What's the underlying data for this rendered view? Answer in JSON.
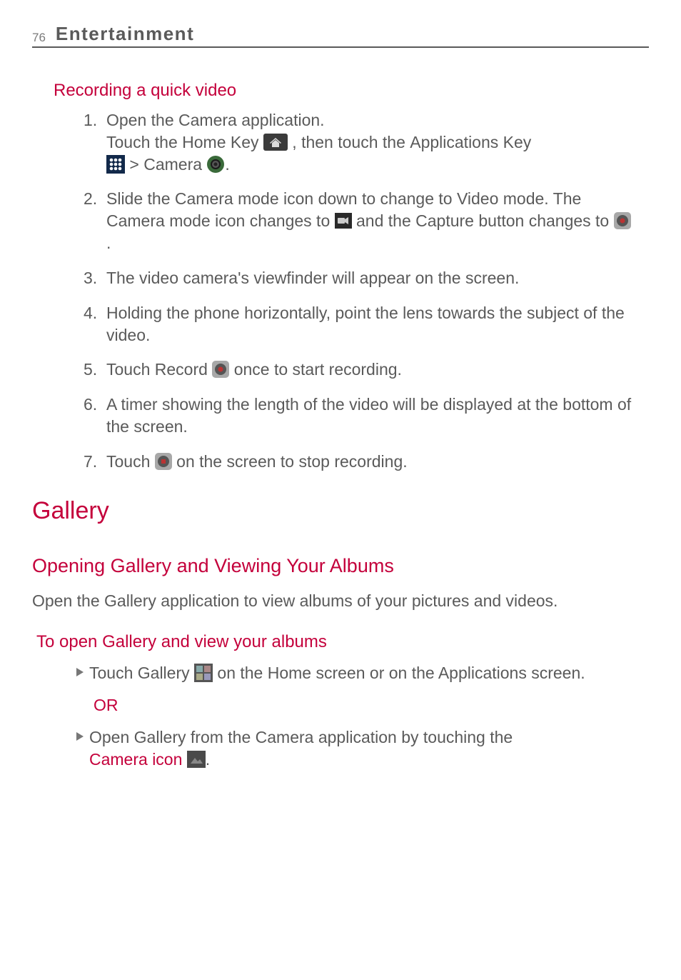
{
  "header": {
    "page_num": "76",
    "section": "Entertainment"
  },
  "recording": {
    "heading": "Recording a quick video",
    "steps": {
      "s1": {
        "n": "1.",
        "a": "Open the Camera application.",
        "b1": "Touch the ",
        "home_key": "Home Key",
        "b2": " , then touch the ",
        "apps_key": "Applications Key",
        "b3": " > ",
        "camera": "Camera",
        "b4": "."
      },
      "s2": {
        "n": "2.",
        "a": "Slide the Camera mode icon down to change to Video mode. The Camera mode icon changes to ",
        "b": " and the Capture button changes to ",
        "c": "."
      },
      "s3": {
        "n": "3.",
        "t": "The video camera's viewfinder will appear on the screen."
      },
      "s4": {
        "n": "4.",
        "t": "Holding the phone horizontally, point the lens towards the subject of the video."
      },
      "s5": {
        "n": "5.",
        "a": "Touch ",
        "rec": "Record",
        "b": " once to start recording."
      },
      "s6": {
        "n": "6.",
        "t": "A timer showing the length of the video will be displayed at the bottom of the screen."
      },
      "s7": {
        "n": "7.",
        "a": "Touch ",
        "b": " on the screen to stop recording."
      }
    }
  },
  "gallery": {
    "h1": "Gallery",
    "h2": "Opening Gallery and Viewing Your Albums",
    "intro_a": "Open the ",
    "intro_gal": "Gallery",
    "intro_b": " application to view albums of your pictures and videos.",
    "h3": "To open Gallery and view your albums",
    "b1": {
      "a": "Touch ",
      "gal": "Gallery",
      "b": " on the Home screen or on the Applications screen."
    },
    "or": "OR",
    "b2": {
      "a": "Open ",
      "gal": "Gallery",
      "b": " from the Camera application by touching the ",
      "cam": "Camera icon",
      "c": "."
    }
  },
  "chart_data": null
}
